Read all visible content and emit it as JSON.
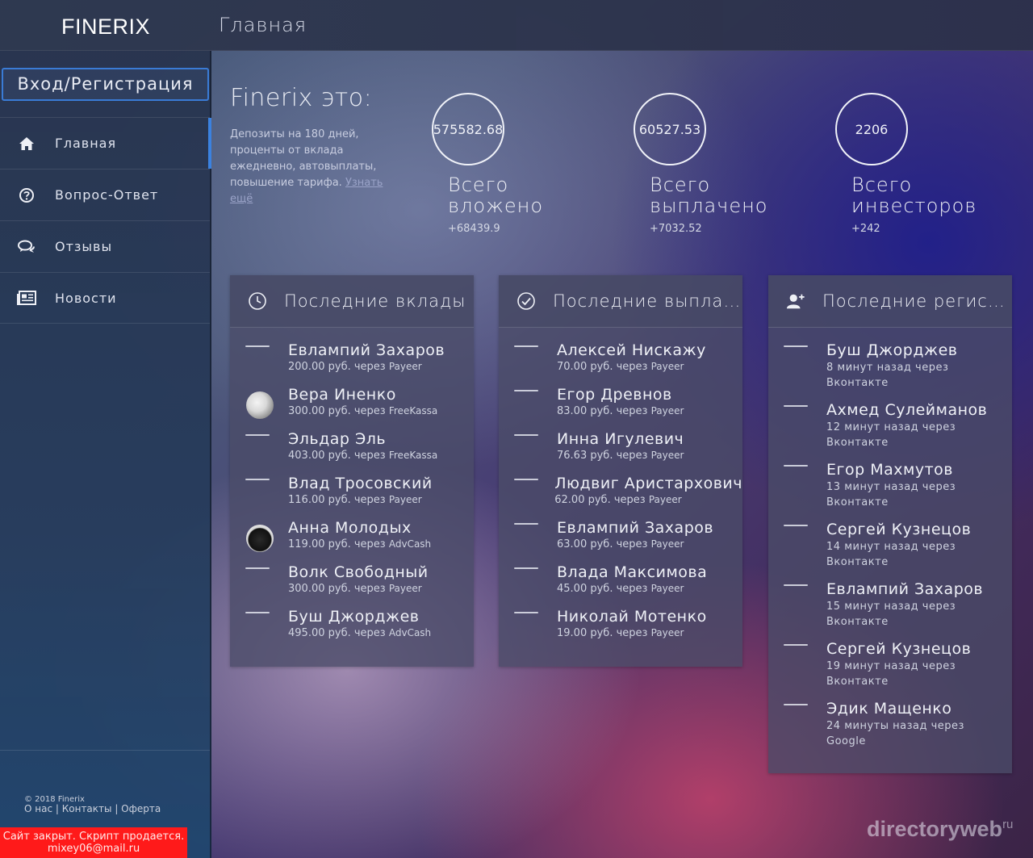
{
  "header": {
    "logo": "FINERIX",
    "title": "Главная"
  },
  "sidebar": {
    "login_label": "Вход/Регистрация",
    "items": [
      {
        "label": "Главная",
        "icon": "home-icon",
        "active": true
      },
      {
        "label": "Вопрос-Ответ",
        "icon": "question-icon",
        "active": false
      },
      {
        "label": "Отзывы",
        "icon": "comments-icon",
        "active": false
      },
      {
        "label": "Новости",
        "icon": "newspaper-icon",
        "active": false
      }
    ],
    "copyright": "© 2018 Finerix",
    "footer_links": [
      "О нас",
      "Контакты",
      "Оферта"
    ],
    "closed_notice_line1": "Сайт закрыт. Скрипт продается.",
    "closed_notice_line2": "mixey06@mail.ru"
  },
  "intro": {
    "title": "Finerix это:",
    "text": "Депозиты на 180 дней, проценты от вклада ежедневно, автовыплаты, повышение тарифа. ",
    "more_link": "Узнать ещё"
  },
  "stats": [
    {
      "value": "575582.68",
      "label_line1": "Всего",
      "label_line2": "вложено",
      "delta": "+68439.9"
    },
    {
      "value": "60527.53",
      "label_line1": "Всего",
      "label_line2": "выплачено",
      "delta": "+7032.52"
    },
    {
      "value": "2206",
      "label_line1": "Всего",
      "label_line2": "инвесторов",
      "delta": "+242"
    }
  ],
  "deposits": {
    "title": "Последние вклады",
    "icon": "clock-icon",
    "rows": [
      {
        "name": "Евлампий Захаров",
        "amount": "200.00",
        "text": "руб. через",
        "system": "Payeer",
        "avatar": "none"
      },
      {
        "name": "Вера Иненко",
        "amount": "300.00",
        "text": "руб. через",
        "system": "FreeKassa",
        "avatar": "egg"
      },
      {
        "name": "Эльдар Эль",
        "amount": "403.00",
        "text": "руб. через",
        "system": "FreeKassa",
        "avatar": "none"
      },
      {
        "name": "Влад Тросовский",
        "amount": "116.00",
        "text": "руб. через",
        "system": "Payeer",
        "avatar": "none"
      },
      {
        "name": "Анна Молодых",
        "amount": "119.00",
        "text": "руб. через",
        "system": "AdvCash",
        "avatar": "cat"
      },
      {
        "name": "Волк Свободный",
        "amount": "300.00",
        "text": "руб. через",
        "system": "Payeer",
        "avatar": "none"
      },
      {
        "name": "Буш Джорджев",
        "amount": "495.00",
        "text": "руб. через",
        "system": "AdvCash",
        "avatar": "none"
      }
    ]
  },
  "payouts": {
    "title": "Последние выплаты",
    "icon": "check-circle-icon",
    "rows": [
      {
        "name": "Алексей Нискажу",
        "amount": "70.00",
        "text": "руб. через",
        "system": "Payeer"
      },
      {
        "name": "Егор Древнов",
        "amount": "83.00",
        "text": "руб. через",
        "system": "Payeer"
      },
      {
        "name": "Инна Игулевич",
        "amount": "76.63",
        "text": "руб. через",
        "system": "Payeer"
      },
      {
        "name": "Людвиг Аристархович",
        "amount": "62.00",
        "text": "руб. через",
        "system": "Payeer"
      },
      {
        "name": "Евлампий Захаров",
        "amount": "63.00",
        "text": "руб. через",
        "system": "Payeer"
      },
      {
        "name": "Влада Максимова",
        "amount": "45.00",
        "text": "руб. через",
        "system": "Payeer"
      },
      {
        "name": "Николай Мотенко",
        "amount": "19.00",
        "text": "руб. через",
        "system": "Payeer"
      }
    ]
  },
  "registrations": {
    "title": "Последние регистрации",
    "icon": "user-plus-icon",
    "rows": [
      {
        "name": "Буш Джорджев",
        "n": "8",
        "time": "минут назад через",
        "source": "Вконтакте"
      },
      {
        "name": "Ахмед Сулейманов",
        "n": "12",
        "time": "минут назад через",
        "source": "Вконтакте"
      },
      {
        "name": "Егор Махмутов",
        "n": "13",
        "time": "минут назад через",
        "source": "Вконтакте"
      },
      {
        "name": "Сергей Кузнецов",
        "n": "14",
        "time": "минут назад через",
        "source": "Вконтакте"
      },
      {
        "name": "Евлампий Захаров",
        "n": "15",
        "time": "минут назад через",
        "source": "Вконтакте"
      },
      {
        "name": "Сергей Кузнецов",
        "n": "19",
        "time": "минут назад через",
        "source": "Вконтакте"
      },
      {
        "name": "Эдик Мащенко",
        "n": "24",
        "time": "минуты назад через",
        "source": "Google"
      }
    ]
  },
  "watermark": {
    "text": "directoryweb",
    "sup": "ru"
  }
}
